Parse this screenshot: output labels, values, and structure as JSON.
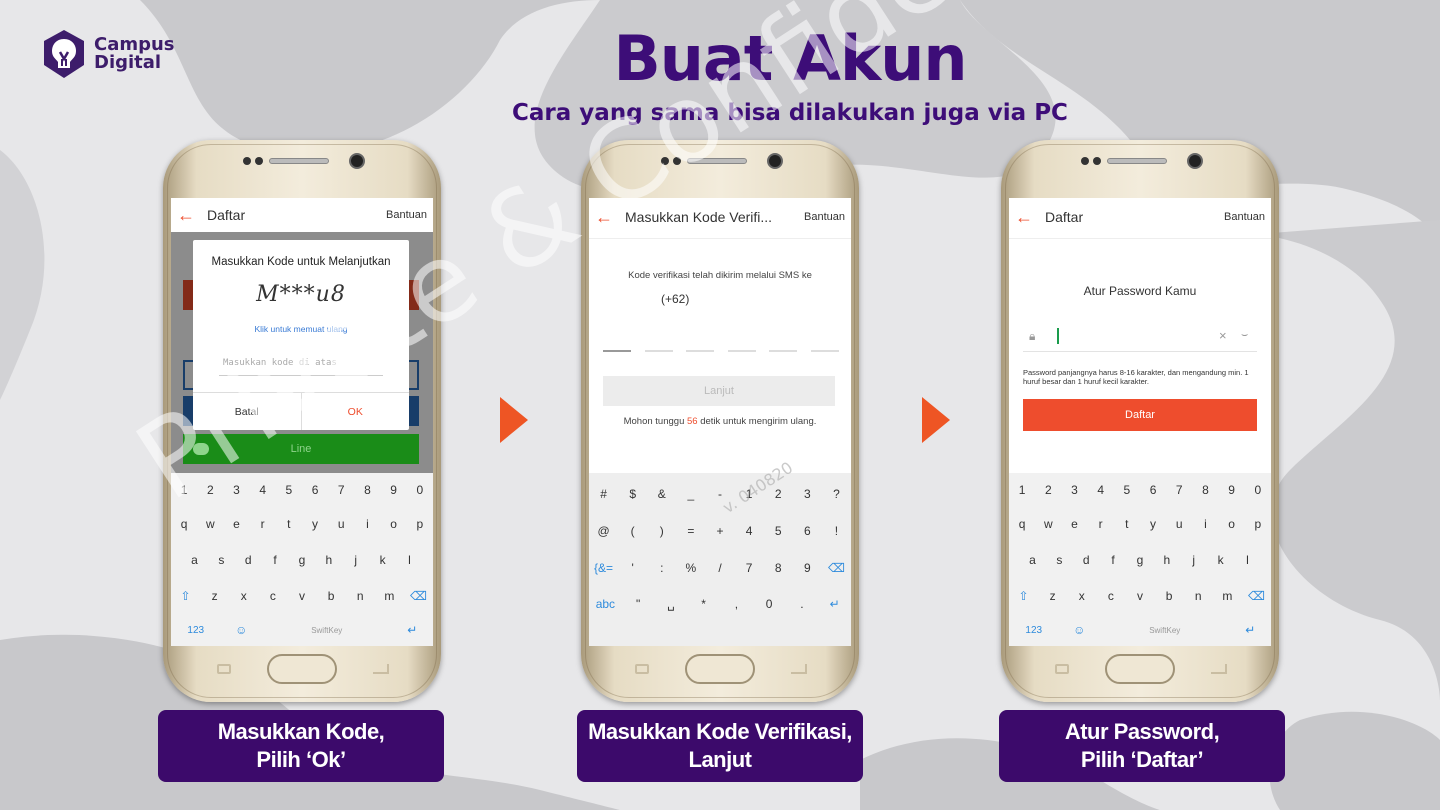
{
  "logo": {
    "line1": "Campus",
    "line2": "Digital"
  },
  "header": {
    "title": "Buat Akun",
    "subtitle": "Cara yang sama bisa dilakukan juga via PC"
  },
  "watermark": {
    "text": "Private & Confidential",
    "version": "v. 040820"
  },
  "keyboard_letters": {
    "numbers": [
      "1",
      "2",
      "3",
      "4",
      "5",
      "6",
      "7",
      "8",
      "9",
      "0"
    ],
    "row1": [
      "q",
      "w",
      "e",
      "r",
      "t",
      "y",
      "u",
      "i",
      "o",
      "p"
    ],
    "row2": [
      "a",
      "s",
      "d",
      "f",
      "g",
      "h",
      "j",
      "k",
      "l"
    ],
    "row3": [
      "z",
      "x",
      "c",
      "v",
      "b",
      "n",
      "m"
    ],
    "bottom_left": "123",
    "brand": "SwiftKey"
  },
  "keyboard_symbols": {
    "row1": [
      "#",
      "$",
      "&",
      "_",
      "-",
      "1",
      "2",
      "3",
      "?"
    ],
    "row2": [
      "@",
      "(",
      ")",
      "=",
      "+",
      "4",
      "5",
      "6",
      "!"
    ],
    "row3": [
      "{&=",
      "'",
      ":",
      "%",
      "/",
      "7",
      "8",
      "9",
      "⌫"
    ],
    "row4": [
      "abc",
      "\"",
      "␣",
      "*",
      ",",
      "0",
      ".",
      "↵"
    ]
  },
  "phone1": {
    "appbar": {
      "title": "Daftar",
      "right": "Bantuan"
    },
    "dialog": {
      "title": "Masukkan Kode untuk Melanjutkan",
      "captcha": "M***u8",
      "reload": "Klik untuk memuat ulang",
      "placeholder": "Masukkan kode di atas",
      "cancel": "Batal",
      "ok": "OK"
    },
    "line_button": "Line"
  },
  "phone2": {
    "appbar": {
      "title": "Masukkan Kode Verifi...",
      "right": "Bantuan"
    },
    "info": "Kode verifikasi telah dikirim melalui SMS ke",
    "phone_code": "(+62)",
    "button": "Lanjut",
    "wait_prefix": "Mohon tunggu",
    "wait_seconds": "56",
    "wait_suffix": "detik untuk mengirim ulang."
  },
  "phone3": {
    "appbar": {
      "title": "Daftar",
      "right": "Bantuan"
    },
    "heading": "Atur Password Kamu",
    "note": "Password panjangnya harus 8-16 karakter, dan mengandung min. 1 huruf besar dan 1 huruf kecil karakter.",
    "button": "Daftar"
  },
  "captions": {
    "step1": "Masukkan Kode,\nPilih ‘Ok’",
    "step2": "Masukkan Kode Verifikasi,\nLanjut",
    "step3": "Atur Password,\nPilih ‘Daftar’"
  },
  "colors": {
    "brand_purple": "#3c0a6b",
    "accent_orange": "#ee4d2d",
    "line_green": "#1a8c18"
  }
}
